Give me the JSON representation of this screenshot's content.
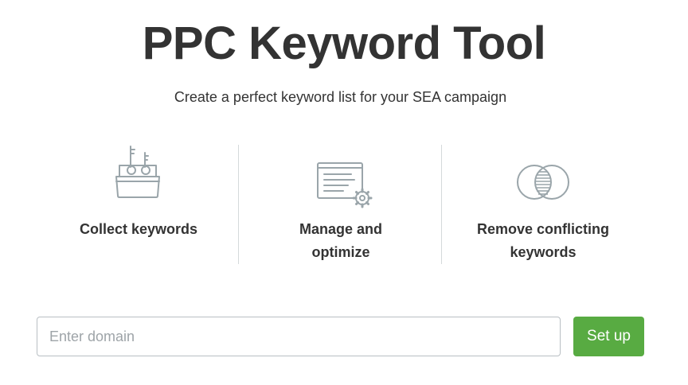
{
  "header": {
    "title": "PPC Keyword Tool",
    "subtitle": "Create a perfect keyword list for your SEA campaign"
  },
  "features": [
    {
      "label_line1": "Collect keywords",
      "label_line2": "",
      "icon": "keyword-basket-icon"
    },
    {
      "label_line1": "Manage and",
      "label_line2": "optimize",
      "icon": "document-settings-icon"
    },
    {
      "label_line1": "Remove conflicting",
      "label_line2": "keywords",
      "icon": "venn-intersection-icon"
    }
  ],
  "form": {
    "domain_placeholder": "Enter domain",
    "domain_value": "",
    "submit_label": "Set up"
  },
  "colors": {
    "accent": "#58ab42",
    "icon": "#9aa5aa",
    "text": "#333333"
  }
}
